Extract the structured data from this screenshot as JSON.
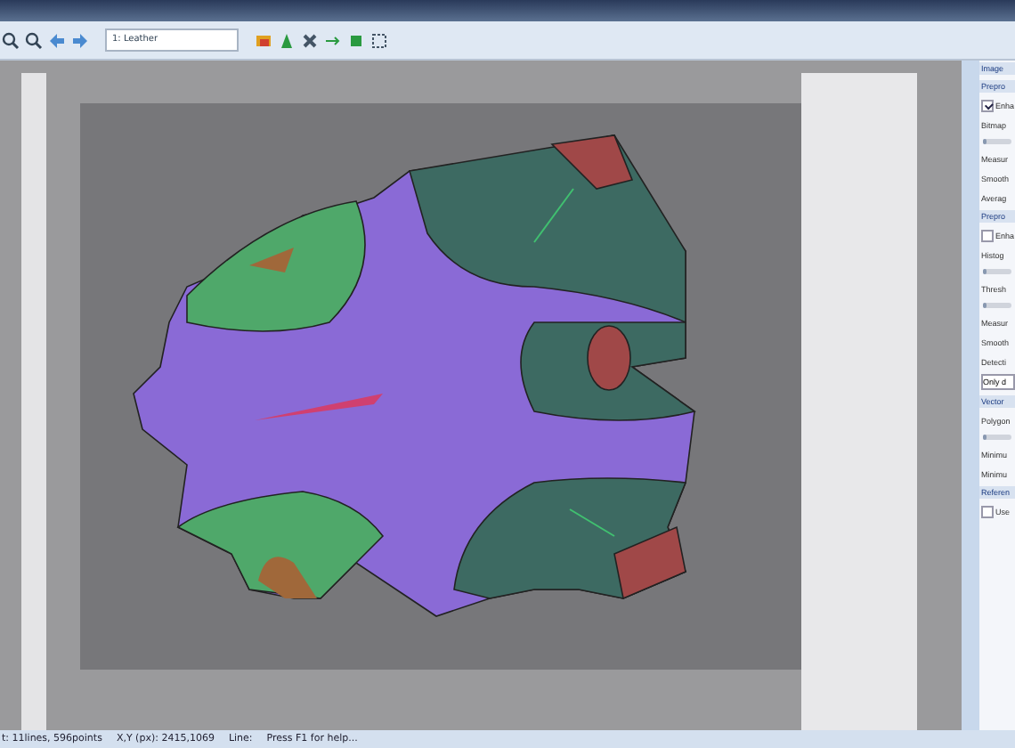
{
  "toolbar": {
    "layer_select": {
      "value": "1: Leather"
    }
  },
  "panel": {
    "items": [
      {
        "kind": "header",
        "label": "Image"
      },
      {
        "kind": "header",
        "label": "Prepro"
      },
      {
        "kind": "checkbox",
        "label": "Enha",
        "checked": true
      },
      {
        "kind": "label",
        "label": "Bitmap"
      },
      {
        "kind": "slider",
        "level": 0.1
      },
      {
        "kind": "label",
        "label": "Measur"
      },
      {
        "kind": "label",
        "label": "Smooth"
      },
      {
        "kind": "label",
        "label": "Averag"
      },
      {
        "kind": "header",
        "label": "Prepro"
      },
      {
        "kind": "checkbox",
        "label": "Enha",
        "checked": false
      },
      {
        "kind": "label",
        "label": "Histog"
      },
      {
        "kind": "slider",
        "level": 0.1
      },
      {
        "kind": "label",
        "label": "Thresh"
      },
      {
        "kind": "slider",
        "level": 0.1
      },
      {
        "kind": "label",
        "label": "Measur"
      },
      {
        "kind": "label",
        "label": "Smooth"
      },
      {
        "kind": "label",
        "label": "Detecti"
      },
      {
        "kind": "dropdown",
        "label": "Only d"
      },
      {
        "kind": "header",
        "label": "Vector"
      },
      {
        "kind": "label",
        "label": "Polygon"
      },
      {
        "kind": "slider",
        "level": 0.1
      },
      {
        "kind": "label",
        "label": "Minimu"
      },
      {
        "kind": "label",
        "label": "Minimu"
      },
      {
        "kind": "header",
        "label": "Referen"
      },
      {
        "kind": "checkbox",
        "label": "Use",
        "checked": false
      }
    ]
  },
  "status_bar": [
    "t: 11lines, 596points",
    "X,Y (px): 2415,1069",
    "Line:",
    "Press F1 for help..."
  ]
}
